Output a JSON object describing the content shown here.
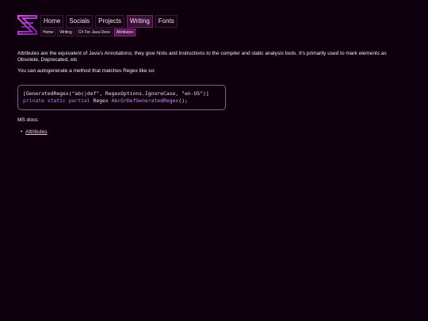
{
  "nav": {
    "main": [
      {
        "label": "Home",
        "active": false
      },
      {
        "label": "Socials",
        "active": false
      },
      {
        "label": "Projects",
        "active": false
      },
      {
        "label": "Writing",
        "active": true
      },
      {
        "label": "Fonts",
        "active": false
      }
    ],
    "breadcrumbs": [
      {
        "label": "Home",
        "active": false
      },
      {
        "label": "Writing",
        "active": false
      },
      {
        "label": "C# For Java Devs",
        "active": false
      },
      {
        "label": "Attributes",
        "active": true
      }
    ]
  },
  "content": {
    "intro": "Attributes are the equivalent of Java's Annotations; they give hints and instructions to the compiler and static analysis tools. It's primarily used to mark elements as Obsolete, Deprecated, etc",
    "autogen": "You can autogenerate a method that matches Regex like so:",
    "code": {
      "line1": {
        "a": "[GeneratedRegex(",
        "b": "\"abc|def\"",
        "c": ", RegexOptions.IgnoreCase, ",
        "d": "\"en-US\"",
        "e": ")]"
      },
      "line2": {
        "kw": "private static partial",
        "type": " Regex ",
        "method": "AbcOrDefGeneratedRegex",
        "end": "();"
      }
    },
    "ms_docs_heading": "MS docs:",
    "ms_docs_links": [
      "Attributes"
    ]
  },
  "colors": {
    "background": "#0f000e",
    "accent": "#c73ad6",
    "active_nav": "#3a0f3a",
    "active_crumb": "#55124f",
    "code_keyword": "#a98af0",
    "link": "#f2c8ee"
  },
  "icons": {
    "logo": "hourglass-z-logo-icon"
  }
}
